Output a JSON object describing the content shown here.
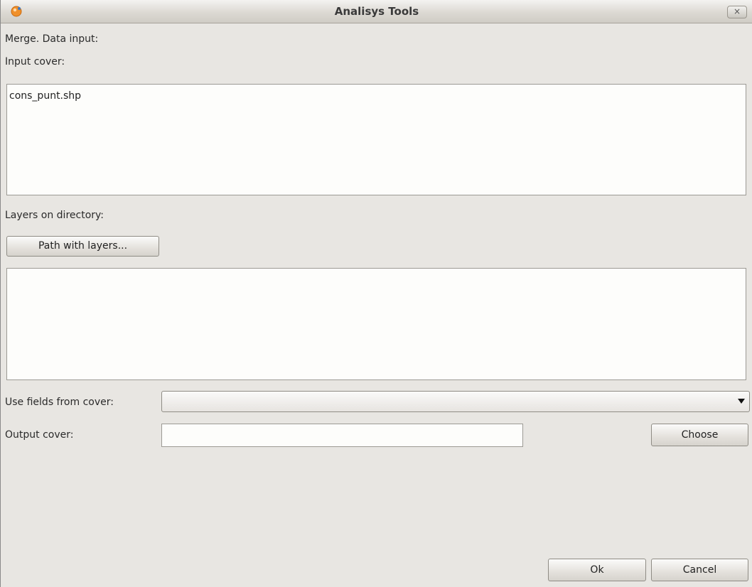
{
  "window": {
    "title": "Analisys Tools",
    "close_label": "×"
  },
  "form": {
    "heading": "Merge. Data input:",
    "input_cover_label": "Input cover:",
    "input_cover_items": [
      "cons_punt.shp"
    ],
    "layers_on_directory_label": "Layers on directory:",
    "path_button_label": "Path with layers...",
    "use_fields_label": "Use fields from cover:",
    "use_fields_value": "",
    "output_cover_label": "Output cover:",
    "output_cover_value": "",
    "choose_button_label": "Choose"
  },
  "footer": {
    "ok_label": "Ok",
    "cancel_label": "Cancel"
  },
  "icons": {
    "app": "gvsig-app-icon",
    "close": "close-icon",
    "dropdown": "chevron-down-icon"
  },
  "colors": {
    "app_icon": "#f0902a"
  }
}
